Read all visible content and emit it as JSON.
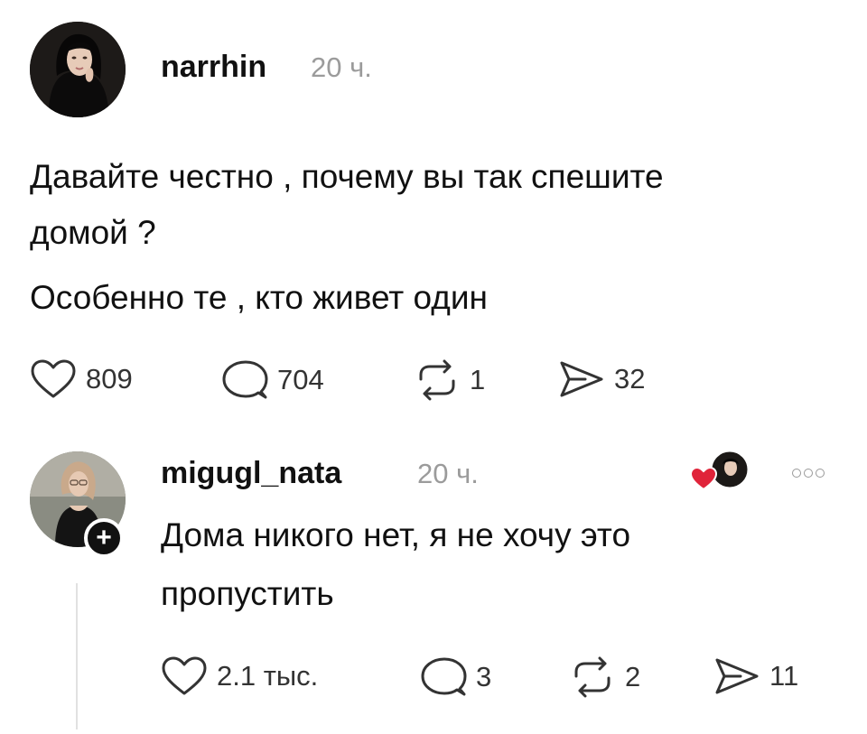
{
  "post": {
    "author": "narrhin",
    "time": "20 ч.",
    "lines": [
      "Давайте честно , почему вы так спешите",
      "домой ?",
      "Особенно те , кто живет один"
    ],
    "stats": {
      "likes": "809",
      "comments": "704",
      "reposts": "1",
      "shares": "32"
    }
  },
  "reply": {
    "author": "migugl_nata",
    "time": "20 ч.",
    "lines": [
      "Дома никого нет, я не хочу это",
      "пропустить"
    ],
    "stats": {
      "likes": "2.1 тыс.",
      "comments": "3",
      "reposts": "2",
      "shares": "11"
    }
  },
  "icons": {
    "like": "heart-icon",
    "comment": "comment-bubble-icon",
    "repost": "repost-icon",
    "share": "send-icon",
    "more": "more-dots-icon",
    "follow": "plus-icon",
    "creator_like": "creator-liked-heart-icon"
  },
  "colors": {
    "time": "#9b9b9b",
    "heart": "#e0243a",
    "text": "#111111"
  }
}
